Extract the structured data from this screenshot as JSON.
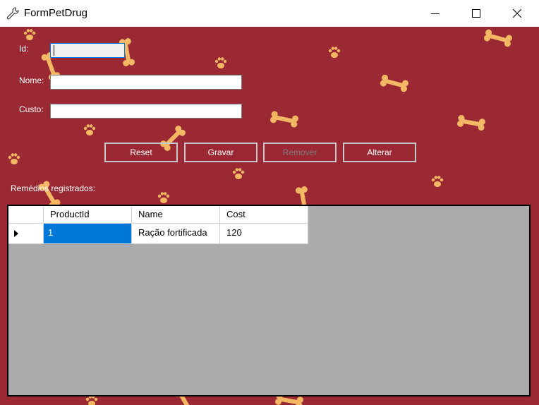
{
  "window": {
    "title": "FormPetDrug",
    "icon": "wrench-icon"
  },
  "colors": {
    "background": "#9a2934",
    "bone": "#f4b865",
    "grid_background": "#ababab",
    "selection": "#0078d7"
  },
  "form": {
    "id_label": "Id:",
    "nome_label": "Nome:",
    "custo_label": "Custo:",
    "id_value": "",
    "nome_value": "",
    "custo_value": ""
  },
  "buttons": {
    "reset": "Reset",
    "gravar": "Gravar",
    "remover": "Remover",
    "alterar": "Alterar"
  },
  "list_label": "Remédios registrados:",
  "grid": {
    "columns": [
      "ProductId",
      "Name",
      "Cost"
    ],
    "rows": [
      [
        "1",
        "Ração fortificada",
        "120"
      ]
    ]
  }
}
